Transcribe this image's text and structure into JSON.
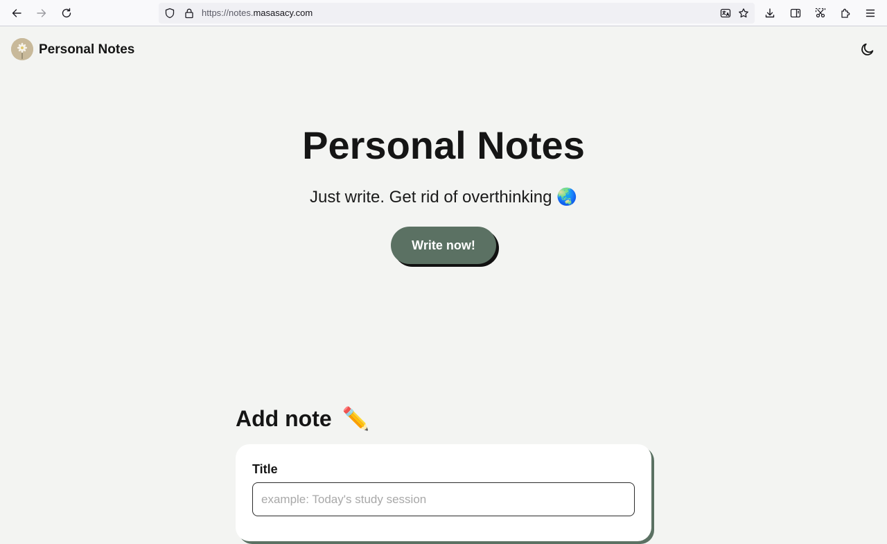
{
  "browser": {
    "url_prefix": "https://notes.",
    "url_domain": "masasacy.com"
  },
  "header": {
    "brand_name": "Personal Notes"
  },
  "hero": {
    "title": "Personal Notes",
    "subtitle": "Just write. Get rid of overthinking 🌏",
    "cta_label": "Write now!"
  },
  "add_note": {
    "heading": "Add note",
    "heading_emoji": "✏️",
    "title_label": "Title",
    "title_placeholder": "example: Today's study session",
    "title_value": ""
  },
  "colors": {
    "page_background": "#f3f4f2",
    "accent_green": "#5b7163",
    "cta_shadow": "#111111",
    "logo_background": "#c8b99a"
  }
}
